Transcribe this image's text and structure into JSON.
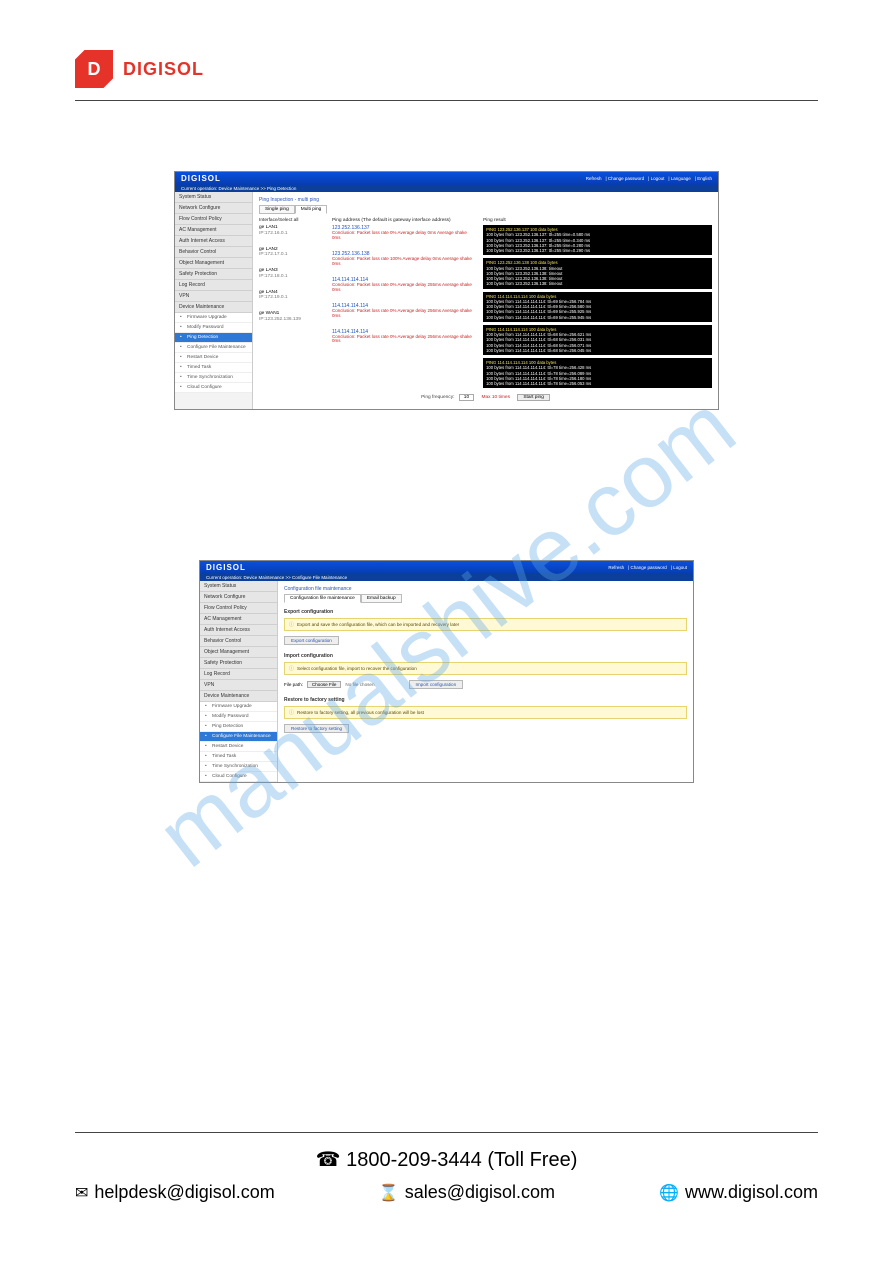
{
  "brand": {
    "logo_letter": "D",
    "logo_text": "DIGISOL"
  },
  "footer": {
    "toll": "☎ 1800-209-3444 (Toll Free)",
    "helpdesk": "helpdesk@digisol.com",
    "sales": "sales@digisol.com",
    "web": "www.digisol.com"
  },
  "watermark": "manualshive.com",
  "shot1": {
    "brand": "DIGISOL",
    "top_links": [
      "Refresh",
      "Change password",
      "Logout",
      "Language",
      "English"
    ],
    "crumb": "Current operation: Device Maintenance >> Ping Detection",
    "page_title": "Ping Inspection - multi ping",
    "tabs": [
      "Single ping",
      "Multi ping"
    ],
    "sidebar_cats": [
      "System Status",
      "Network Configure",
      "Flow Control Policy",
      "AC Management",
      "Auth Internet Access",
      "Behavior Control",
      "Object Management",
      "Safety Protection",
      "Log Record",
      "VPN",
      "Device Maintenance"
    ],
    "sidebar_subs": [
      "Firmware Upgrade",
      "Modify Password",
      "Ping Detection",
      "Configure File Maintenance",
      "Restart Device",
      "Timed Task",
      "Time Synchronization",
      "Cloud Configure"
    ],
    "sidebar_active": "Ping Detection",
    "col_if": "Interface/Select all",
    "col_ping": "Ping address (The default is gateway interface address)",
    "col_res": "Ping result",
    "interfaces": [
      {
        "name": "ge LAN1",
        "ip": "IP:172.16.0.1",
        "addr": "123.252.136.137",
        "concl": "Conclusion: Packet loss rate 0% Average delay 0ms Average shake 0ms",
        "concl_color": "#c22"
      },
      {
        "name": "ge LAN2",
        "ip": "IP:172.17.0.1",
        "addr": "123.252.136.138",
        "concl": "Conclusion: Packet loss rate 100% Average delay 0ms Average shake 0ms",
        "concl_color": "#c22"
      },
      {
        "name": "ge LAN3",
        "ip": "IP:172.18.0.1",
        "addr": "114.114.114.114",
        "concl": "Conclusion: Packet loss rate 0% Average delay 255ms Average shake 0ms",
        "concl_color": "#c22"
      },
      {
        "name": "ge LAN4",
        "ip": "IP:172.19.0.1",
        "addr": "114.114.114.114",
        "concl": "Conclusion: Packet loss rate 0% Average delay 256ms Average shake 0ms",
        "concl_color": "#c22"
      },
      {
        "name": "ge WAN1",
        "ip": "IP:123.252.136.139",
        "addr": "114.114.114.114",
        "concl": "Conclusion: Packet loss rate 0% Average delay 256ms Average shake 0ms",
        "concl_color": "#c22"
      }
    ],
    "terminals": [
      [
        "PING 123.252.136.137 100 data bytes",
        "100 bytes from 123.252.136.137: ttl=255 time=0.580 ms",
        "100 bytes from 123.252.136.137: ttl=255 time=0.340 ms",
        "100 bytes from 123.252.136.137: ttl=255 time=0.280 ms",
        "100 bytes from 123.252.136.137: ttl=255 time=0.290 ms"
      ],
      [
        "PING 123.252.136.138 100 data bytes",
        "100 bytes from 123.252.136.138: timeout",
        "100 bytes from 123.252.136.138: timeout",
        "100 bytes from 123.252.136.138: timeout",
        "100 bytes from 123.252.136.138: timeout"
      ],
      [
        "PING 114.114.114.114 100 data bytes",
        "100 bytes from 114.114.114.114: ttl=69 time=256.784 ms",
        "100 bytes from 114.114.114.114: ttl=69 time=256.580 ms",
        "100 bytes from 114.114.114.114: ttl=69 time=255.925 ms",
        "100 bytes from 114.114.114.114: ttl=69 time=255.945 ms"
      ],
      [
        "PING 114.114.114.114 100 data bytes",
        "100 bytes from 114.114.114.114: ttl=68 time=256.621 ms",
        "100 bytes from 114.114.114.114: ttl=68 time=256.031 ms",
        "100 bytes from 114.114.114.114: ttl=68 time=256.071 ms",
        "100 bytes from 114.114.114.114: ttl=68 time=256.045 ms"
      ],
      [
        "PING 114.114.114.114 100 data bytes",
        "100 bytes from 114.114.114.114: ttl=78 time=256.428 ms",
        "100 bytes from 114.114.114.114: ttl=78 time=256.089 ms",
        "100 bytes from 114.114.114.114: ttl=78 time=256.180 ms",
        "100 bytes from 114.114.114.114: ttl=78 time=256.053 ms"
      ]
    ],
    "freq_label": "Ping frequency:",
    "freq_val": "10",
    "freq_max": "Max 10 times",
    "freq_btn": "Start ping"
  },
  "shot2": {
    "brand": "DIGISOL",
    "top_links": [
      "Refresh",
      "Change password",
      "Logout"
    ],
    "crumb": "Current operation: Device Maintenance >> Configure File Maintenance",
    "page_title": "Configuration file maintenance",
    "tabs": [
      "Configuration file maintenance",
      "Email backup"
    ],
    "sidebar_cats": [
      "System Status",
      "Network Configure",
      "Flow Control Policy",
      "AC Management",
      "Auth Internet Access",
      "Behavior Control",
      "Object Management",
      "Safety Protection",
      "Log Record",
      "VPN",
      "Device Maintenance"
    ],
    "sidebar_subs": [
      "Firmware Upgrade",
      "Modify Password",
      "Ping Detection",
      "Configure File Maintenance",
      "Restart Device",
      "Timed Task",
      "Time Synchronization",
      "Cloud Configure"
    ],
    "sidebar_active": "Configure File Maintenance",
    "export_title": "Export configuration",
    "export_info": "Export and save the configuration file, which can be imported and recovery later",
    "export_btn": "Export configuration",
    "import_title": "Import configuration",
    "import_info": "Select configuration file, import to recover the configuration",
    "file_label": "File path:",
    "choose_btn": "Choose File",
    "nofile": "No file chosen",
    "import_btn": "Import configuration",
    "restore_title": "Restore to factory setting",
    "restore_info": "Restore to factory setting, all previous configuration will be lost",
    "restore_btn": "Restore to factory setting"
  }
}
